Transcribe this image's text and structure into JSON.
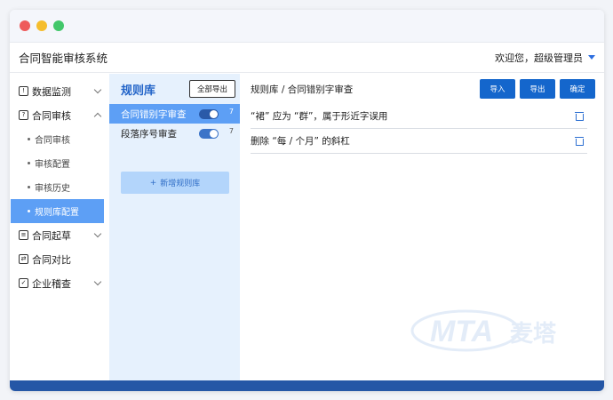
{
  "app": {
    "title": "合同智能审核系统",
    "welcome": "欢迎您，超级管理员"
  },
  "nav": {
    "items": [
      {
        "label": "数据监测",
        "icon": "monitor-icon",
        "chevron": "down"
      },
      {
        "label": "合同审核",
        "icon": "contract-review-icon",
        "chevron": "up",
        "children": [
          {
            "label": "合同审核",
            "active": false
          },
          {
            "label": "审核配置",
            "active": false
          },
          {
            "label": "审核历史",
            "active": false
          },
          {
            "label": "规则库配置",
            "active": true
          }
        ]
      },
      {
        "label": "合同起草",
        "icon": "draft-icon",
        "chevron": "down"
      },
      {
        "label": "合同对比",
        "icon": "compare-icon",
        "chevron": null
      },
      {
        "label": "企业稽查",
        "icon": "audit-icon",
        "chevron": "down"
      }
    ]
  },
  "rules": {
    "title": "规则库",
    "export_all": "全部导出",
    "items": [
      {
        "label": "合同错别字审查",
        "count": "7",
        "enabled": true,
        "active": true
      },
      {
        "label": "段落序号审查",
        "count": "7",
        "enabled": true,
        "active": false
      }
    ],
    "add_label": "新增规则库"
  },
  "main": {
    "breadcrumb": "规则库 / 合同错别字审查",
    "buttons": {
      "import": "导入",
      "export": "导出",
      "confirm": "确定"
    },
    "entries": [
      "“裙” 应为 “群”，属于形近字误用",
      "删除 “每 / 个月” 的斜杠"
    ]
  },
  "watermark": {
    "text": "MTA",
    "brand": "麦塔"
  },
  "colors": {
    "accent": "#1466cc",
    "active_bg": "#5d9ff5",
    "panel_bg": "#e6f1fd",
    "footer": "#2557a6"
  }
}
